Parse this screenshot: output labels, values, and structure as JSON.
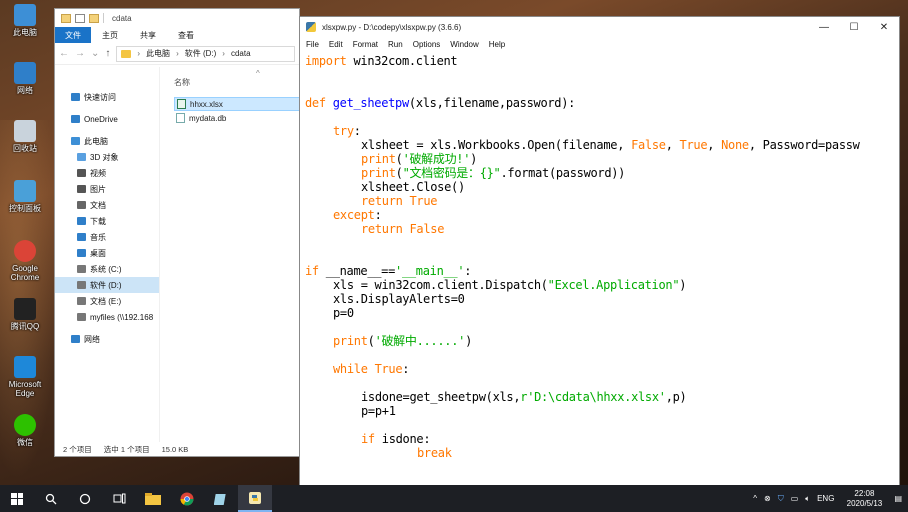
{
  "desktop": {
    "icons": [
      {
        "label": "此电脑",
        "color": "#3d8fd6"
      },
      {
        "label": "网络",
        "color": "#2f7fc9"
      },
      {
        "label": "回收站",
        "color": "#c9d3dc"
      },
      {
        "label": "控制面板",
        "color": "#4aa0d8"
      },
      {
        "label": "Google Chrome",
        "color": "#db4437"
      },
      {
        "label": "腾讯QQ",
        "color": "#222222"
      },
      {
        "label": "Microsoft Edge",
        "color": "#1e88d9"
      },
      {
        "label": "微信",
        "color": "#2dc100"
      }
    ]
  },
  "explorer": {
    "title": "cdata",
    "ribbon_tabs": {
      "file": "文件",
      "home": "主页",
      "share": "共享",
      "view": "查看"
    },
    "breadcrumb": [
      "此电脑",
      "软件 (D:)",
      "cdata"
    ],
    "nav_items": [
      {
        "label": "快速访问",
        "icon_color": "#2f7fc9",
        "indent": 0
      },
      {
        "label": "OneDrive",
        "icon_color": "#2f7fc9",
        "indent": 0
      },
      {
        "label": "此电脑",
        "icon_color": "#3d8fd6",
        "indent": 0
      },
      {
        "label": "3D 对象",
        "icon_color": "#5aa0e0",
        "indent": 1
      },
      {
        "label": "视频",
        "icon_color": "#555555",
        "indent": 1
      },
      {
        "label": "图片",
        "icon_color": "#555555",
        "indent": 1
      },
      {
        "label": "文档",
        "icon_color": "#666666",
        "indent": 1
      },
      {
        "label": "下载",
        "icon_color": "#2f7fc9",
        "indent": 1
      },
      {
        "label": "音乐",
        "icon_color": "#2f7fc9",
        "indent": 1
      },
      {
        "label": "桌面",
        "icon_color": "#2f7fc9",
        "indent": 1
      },
      {
        "label": "系统 (C:)",
        "icon_color": "#777777",
        "indent": 1
      },
      {
        "label": "软件 (D:)",
        "icon_color": "#777777",
        "indent": 1,
        "selected": true
      },
      {
        "label": "文档 (E:)",
        "icon_color": "#777777",
        "indent": 1
      },
      {
        "label": "myfiles (\\\\192.168",
        "icon_color": "#777777",
        "indent": 1
      },
      {
        "label": "网络",
        "icon_color": "#2f7fc9",
        "indent": 0
      }
    ],
    "column_header": "名称",
    "files": [
      {
        "name": "hhxx.xlsx",
        "type": "xl",
        "selected": true
      },
      {
        "name": "mydata.db",
        "type": "db",
        "selected": false
      }
    ],
    "status": {
      "count": "2 个项目",
      "selection": "选中 1 个项目",
      "size": "15.0 KB"
    }
  },
  "idle": {
    "title": "xlsxpw.py - D:\\codepy\\xlsxpw.py (3.6.6)",
    "menu": [
      "File",
      "Edit",
      "Format",
      "Run",
      "Options",
      "Window",
      "Help"
    ],
    "code_lines": [
      {
        "row": 0,
        "indent": 0,
        "parts": [
          {
            "t": "import",
            "c": "kw"
          },
          {
            "t": " win32com.client",
            "c": ""
          }
        ]
      },
      {
        "row": 3,
        "indent": 0,
        "parts": [
          {
            "t": "def",
            "c": "kw"
          },
          {
            "t": " ",
            "c": ""
          },
          {
            "t": "get_sheetpw",
            "c": "df"
          },
          {
            "t": "(xls,filename,password):",
            "c": ""
          }
        ]
      },
      {
        "row": 5,
        "indent": 4,
        "parts": [
          {
            "t": "try",
            "c": "kw"
          },
          {
            "t": ":",
            "c": ""
          }
        ]
      },
      {
        "row": 6,
        "indent": 8,
        "parts": [
          {
            "t": "xlsheet = xls.Workbooks.Open(filename, ",
            "c": ""
          },
          {
            "t": "False",
            "c": "kw"
          },
          {
            "t": ", ",
            "c": ""
          },
          {
            "t": "True",
            "c": "kw"
          },
          {
            "t": ", ",
            "c": ""
          },
          {
            "t": "None",
            "c": "kw"
          },
          {
            "t": ", Password=passw",
            "c": ""
          }
        ]
      },
      {
        "row": 7,
        "indent": 8,
        "parts": [
          {
            "t": "print",
            "c": "kw"
          },
          {
            "t": "(",
            "c": ""
          },
          {
            "t": "'破解成功!'",
            "c": "st"
          },
          {
            "t": ")",
            "c": ""
          }
        ]
      },
      {
        "row": 8,
        "indent": 8,
        "parts": [
          {
            "t": "print",
            "c": "kw"
          },
          {
            "t": "(",
            "c": ""
          },
          {
            "t": "\"文档密码是：{}\"",
            "c": "st"
          },
          {
            "t": ".format(password))",
            "c": ""
          }
        ]
      },
      {
        "row": 9,
        "indent": 8,
        "parts": [
          {
            "t": "xlsheet.Close()",
            "c": ""
          }
        ]
      },
      {
        "row": 10,
        "indent": 8,
        "parts": [
          {
            "t": "return",
            "c": "kw"
          },
          {
            "t": " ",
            "c": ""
          },
          {
            "t": "True",
            "c": "kw"
          }
        ]
      },
      {
        "row": 11,
        "indent": 4,
        "parts": [
          {
            "t": "except",
            "c": "kw"
          },
          {
            "t": ":",
            "c": ""
          }
        ]
      },
      {
        "row": 12,
        "indent": 8,
        "parts": [
          {
            "t": "return",
            "c": "kw"
          },
          {
            "t": " ",
            "c": ""
          },
          {
            "t": "False",
            "c": "kw"
          }
        ]
      },
      {
        "row": 15,
        "indent": 0,
        "parts": [
          {
            "t": "if",
            "c": "kw"
          },
          {
            "t": " __name__==",
            "c": ""
          },
          {
            "t": "'__main__'",
            "c": "st"
          },
          {
            "t": ":",
            "c": ""
          }
        ]
      },
      {
        "row": 16,
        "indent": 4,
        "parts": [
          {
            "t": "xls = win32com.client.Dispatch(",
            "c": ""
          },
          {
            "t": "\"Excel.Application\"",
            "c": "st"
          },
          {
            "t": ")",
            "c": ""
          }
        ]
      },
      {
        "row": 17,
        "indent": 4,
        "parts": [
          {
            "t": "xls.DisplayAlerts=0",
            "c": ""
          }
        ]
      },
      {
        "row": 18,
        "indent": 4,
        "parts": [
          {
            "t": "p=0",
            "c": ""
          }
        ]
      },
      {
        "row": 20,
        "indent": 4,
        "parts": [
          {
            "t": "print",
            "c": "kw"
          },
          {
            "t": "(",
            "c": ""
          },
          {
            "t": "'破解中......'",
            "c": "st"
          },
          {
            "t": ")",
            "c": ""
          }
        ]
      },
      {
        "row": 22,
        "indent": 4,
        "parts": [
          {
            "t": "while",
            "c": "kw"
          },
          {
            "t": " ",
            "c": ""
          },
          {
            "t": "True",
            "c": "kw"
          },
          {
            "t": ":",
            "c": ""
          }
        ]
      },
      {
        "row": 24,
        "indent": 8,
        "parts": [
          {
            "t": "isdone=get_sheetpw(xls,",
            "c": ""
          },
          {
            "t": "r'D:\\cdata\\hhxx.xlsx'",
            "c": "st"
          },
          {
            "t": ",p)",
            "c": ""
          }
        ]
      },
      {
        "row": 25,
        "indent": 8,
        "parts": [
          {
            "t": "p=p+1",
            "c": ""
          }
        ]
      },
      {
        "row": 27,
        "indent": 8,
        "parts": [
          {
            "t": "if",
            "c": "kw"
          },
          {
            "t": " isdone:",
            "c": ""
          }
        ]
      },
      {
        "row": 28,
        "indent": 16,
        "parts": [
          {
            "t": "break",
            "c": "kw"
          }
        ]
      }
    ]
  },
  "taskbar": {
    "ime": "ENG",
    "time": "22:08",
    "date": "2020/5/13"
  }
}
